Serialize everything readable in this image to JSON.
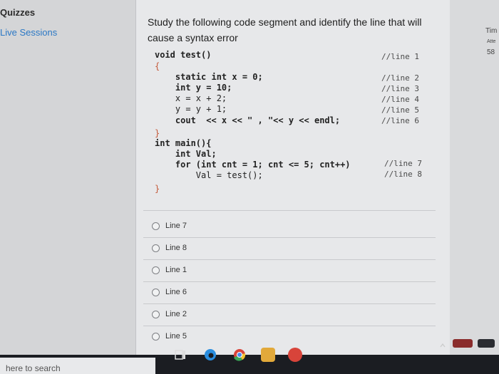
{
  "sidebar": {
    "title": "Quizzes",
    "link": "Live Sessions"
  },
  "question": {
    "text": "Study the following code segment and identify the line that will cause a syntax error"
  },
  "code": {
    "lines": [
      "void test()",
      "{",
      "    static int x = 0;",
      "    int y = 10;",
      "    x = x + 2;",
      "    y = y + 1;",
      "    cout  << x << \" , \"<< y << endl;",
      "}",
      "int main(){",
      "    int Val;",
      "    for (int cnt = 1; cnt <= 5; cnt++)",
      "        Val = test();",
      "}"
    ],
    "comments": [
      "//line 1",
      "//line 2",
      "//line 3",
      "//line 4",
      "//line 5",
      "//line 6",
      "//line 7",
      "//line 8"
    ]
  },
  "options": [
    "Line 7",
    "Line 8",
    "Line 1",
    "Line 6",
    "Line 2",
    "Line 5"
  ],
  "right_panel": {
    "line1": "Tim",
    "line2": "Atte",
    "line3": "58"
  },
  "taskbar": {
    "search_text": "here to search"
  }
}
